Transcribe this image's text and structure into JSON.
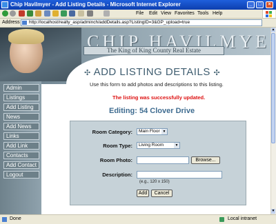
{
  "window": {
    "title": "Chip Havilmyer - Add Listing Details - Microsoft Internet Explorer"
  },
  "menu": {
    "file": "File",
    "edit": "Edit",
    "view": "View",
    "favorites": "Favorites",
    "tools": "Tools",
    "help": "Help"
  },
  "address": {
    "label": "Address",
    "url": "http://localhost/realty_asp/adminch/addDetails.asp?ListingID=3&GP_upload=true",
    "links": "»"
  },
  "banner": {
    "name": "CHIP HAVILMYER",
    "tagline": "The King of King County Real Estate"
  },
  "nav": {
    "items": [
      {
        "label": "Admin"
      },
      {
        "label": "Listings"
      },
      {
        "label": "Add Listing"
      },
      {
        "label": "News"
      },
      {
        "label": "Add News"
      },
      {
        "label": "Links"
      },
      {
        "label": "Add Link"
      },
      {
        "label": "Contacts"
      },
      {
        "label": "Add Contact"
      },
      {
        "label": "Logout"
      }
    ]
  },
  "main": {
    "heading": "ADD LISTING DETAILS",
    "instructions": "Use this form to add photos and descriptions to this listing.",
    "success": "The listing was successfully updated.",
    "editing": "Editing: 54 Clover Drive"
  },
  "form": {
    "room_category_label": "Room Category:",
    "room_category_value": "Main Floor",
    "room_type_label": "Room Type:",
    "room_type_value": "Living Room",
    "room_photo_label": "Room Photo:",
    "browse_label": "Browse...",
    "description_label": "Description:",
    "hint": "(e.g., 120 x 150)",
    "add_label": "Add",
    "cancel_label": "Cancel"
  },
  "status": {
    "text": "Done",
    "zone": "Local intranet"
  }
}
